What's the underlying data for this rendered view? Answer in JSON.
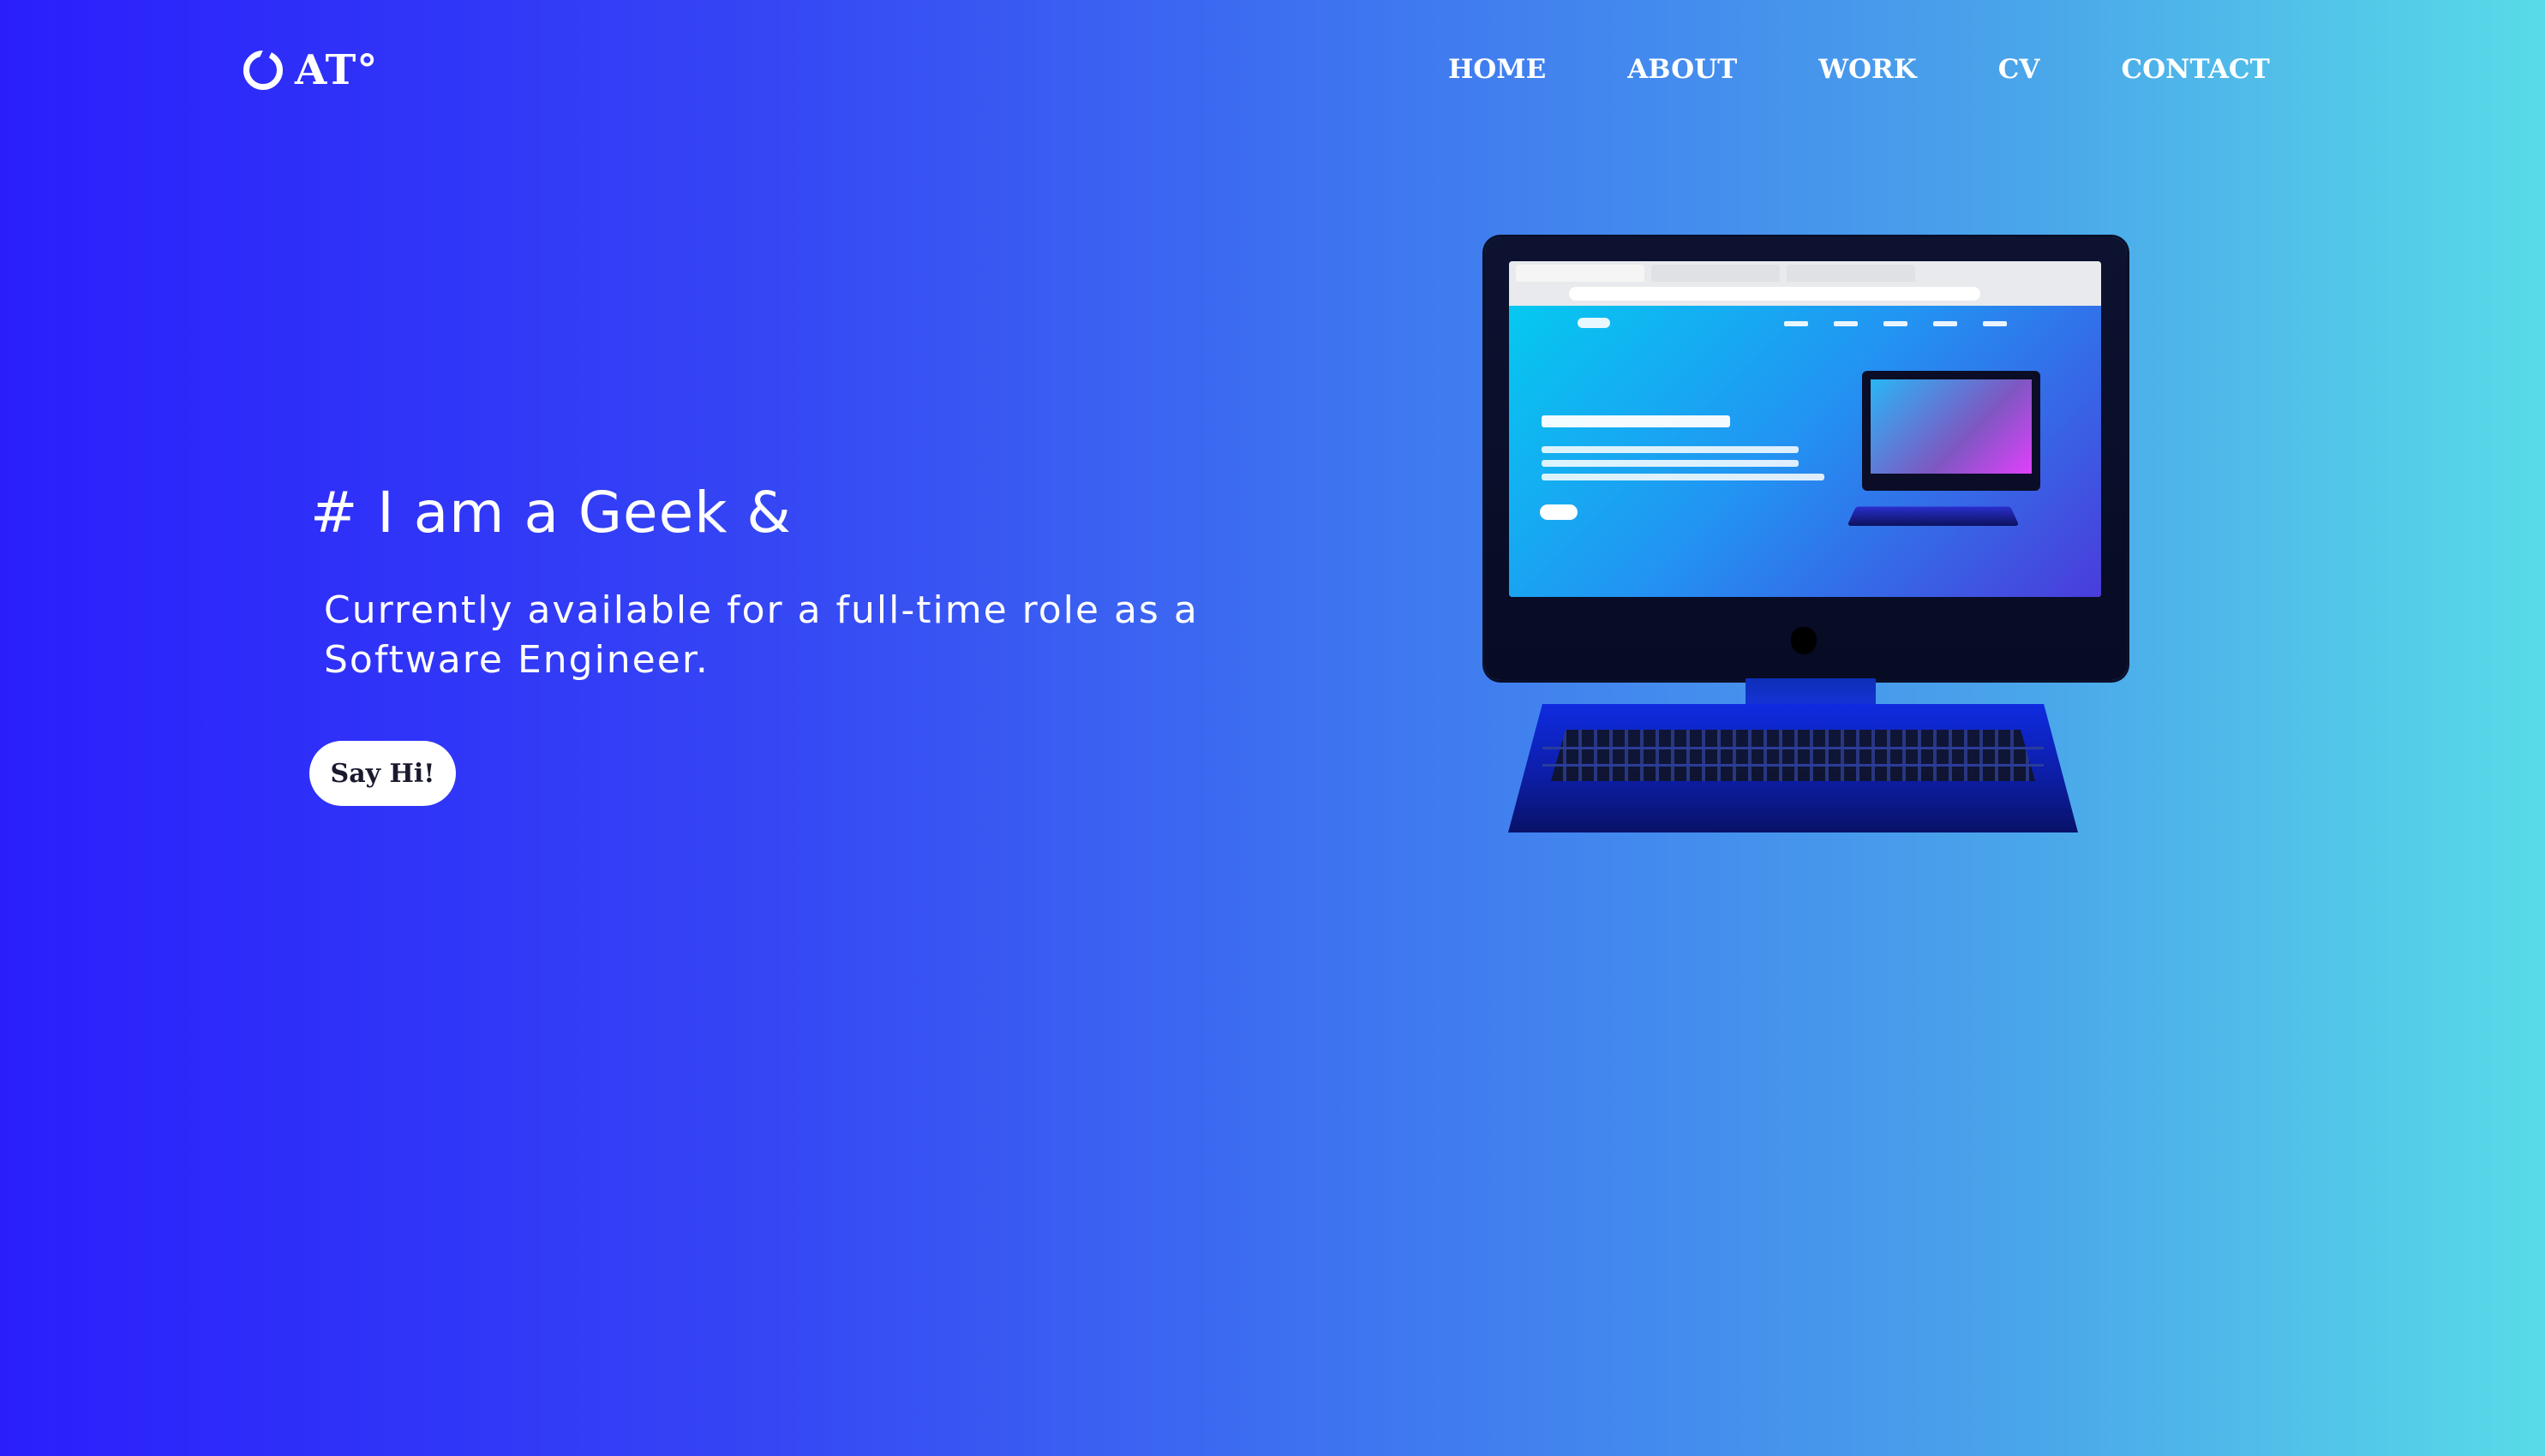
{
  "logo": {
    "text": "AT°",
    "icon": "ring-icon"
  },
  "nav": {
    "items": [
      {
        "label": "HOME"
      },
      {
        "label": "ABOUT"
      },
      {
        "label": "WORK"
      },
      {
        "label": "CV"
      },
      {
        "label": "CONTACT"
      }
    ]
  },
  "hero": {
    "heading": "# I am a Geek &",
    "subtitle": "Currently available for a full-time role as a Software Engineer.",
    "button_label": "Say Hi!"
  },
  "illustration": {
    "name": "desktop-computer-illustration"
  },
  "colors": {
    "gradient_start": "#2a1ffc",
    "gradient_end": "#58dbe8",
    "button_bg": "#ffffff",
    "button_text": "#1a1a2e"
  }
}
